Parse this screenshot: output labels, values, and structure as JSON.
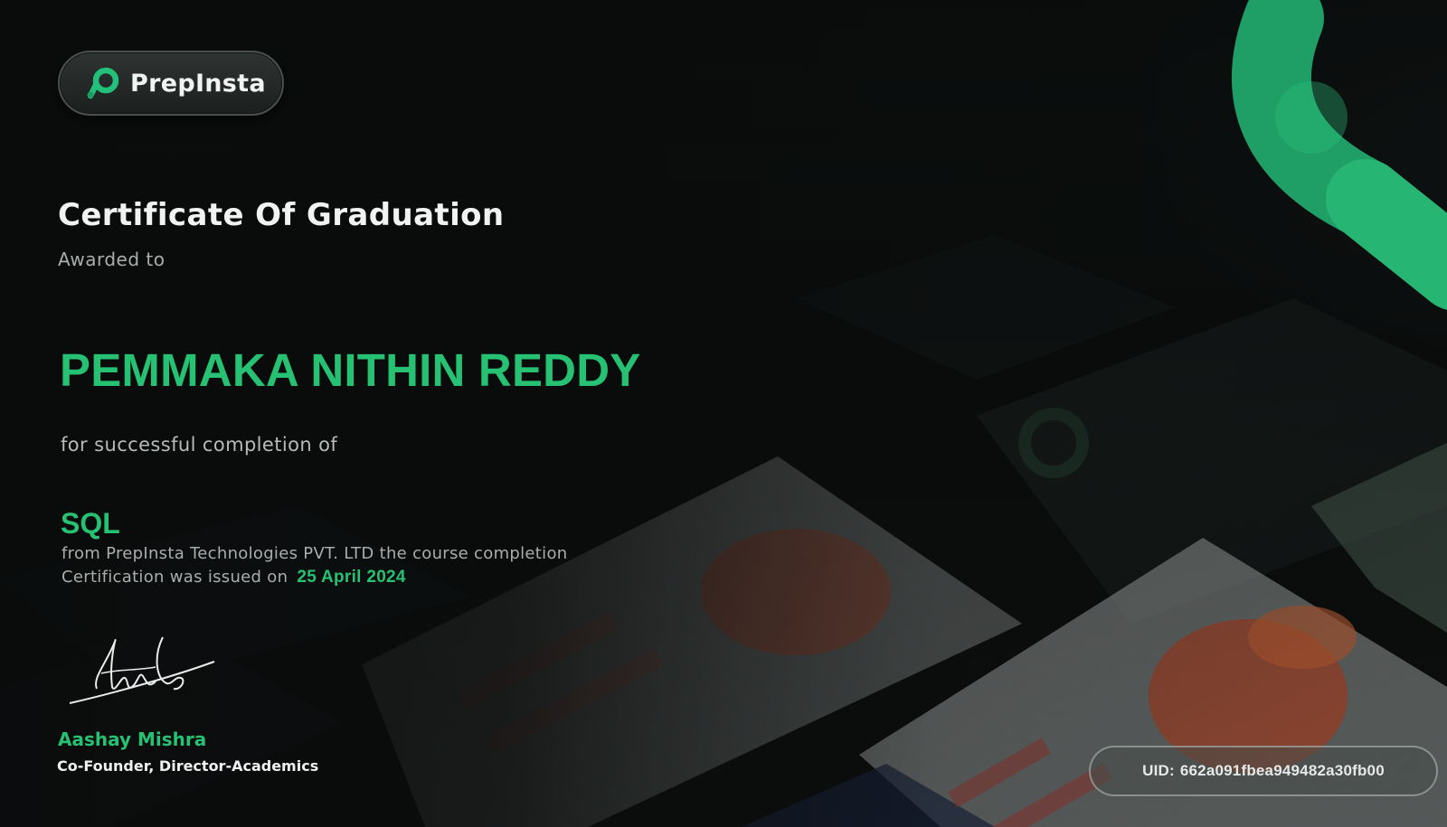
{
  "logo": {
    "text": "PrepInsta"
  },
  "certificate": {
    "title": "Certificate Of Graduation",
    "awarded_label": "Awarded to",
    "recipient": "PEMMAKA NITHIN REDDY",
    "completion_label": "for successful completion of",
    "course": "SQL",
    "description_line1": "from PrepInsta Technologies PVT. LTD the course completion",
    "description_line2": "Certification was issued on",
    "issue_date": "25 April 2024"
  },
  "signatory": {
    "name": "Aashay Mishra",
    "role": "Co-Founder, Director-Academics"
  },
  "uid": {
    "label": "UID:",
    "value": "662a091fbea949482a30fb00"
  },
  "colors": {
    "accent": "#26c173",
    "background": "#0b0d0d",
    "text_muted": "#a8aeac"
  }
}
